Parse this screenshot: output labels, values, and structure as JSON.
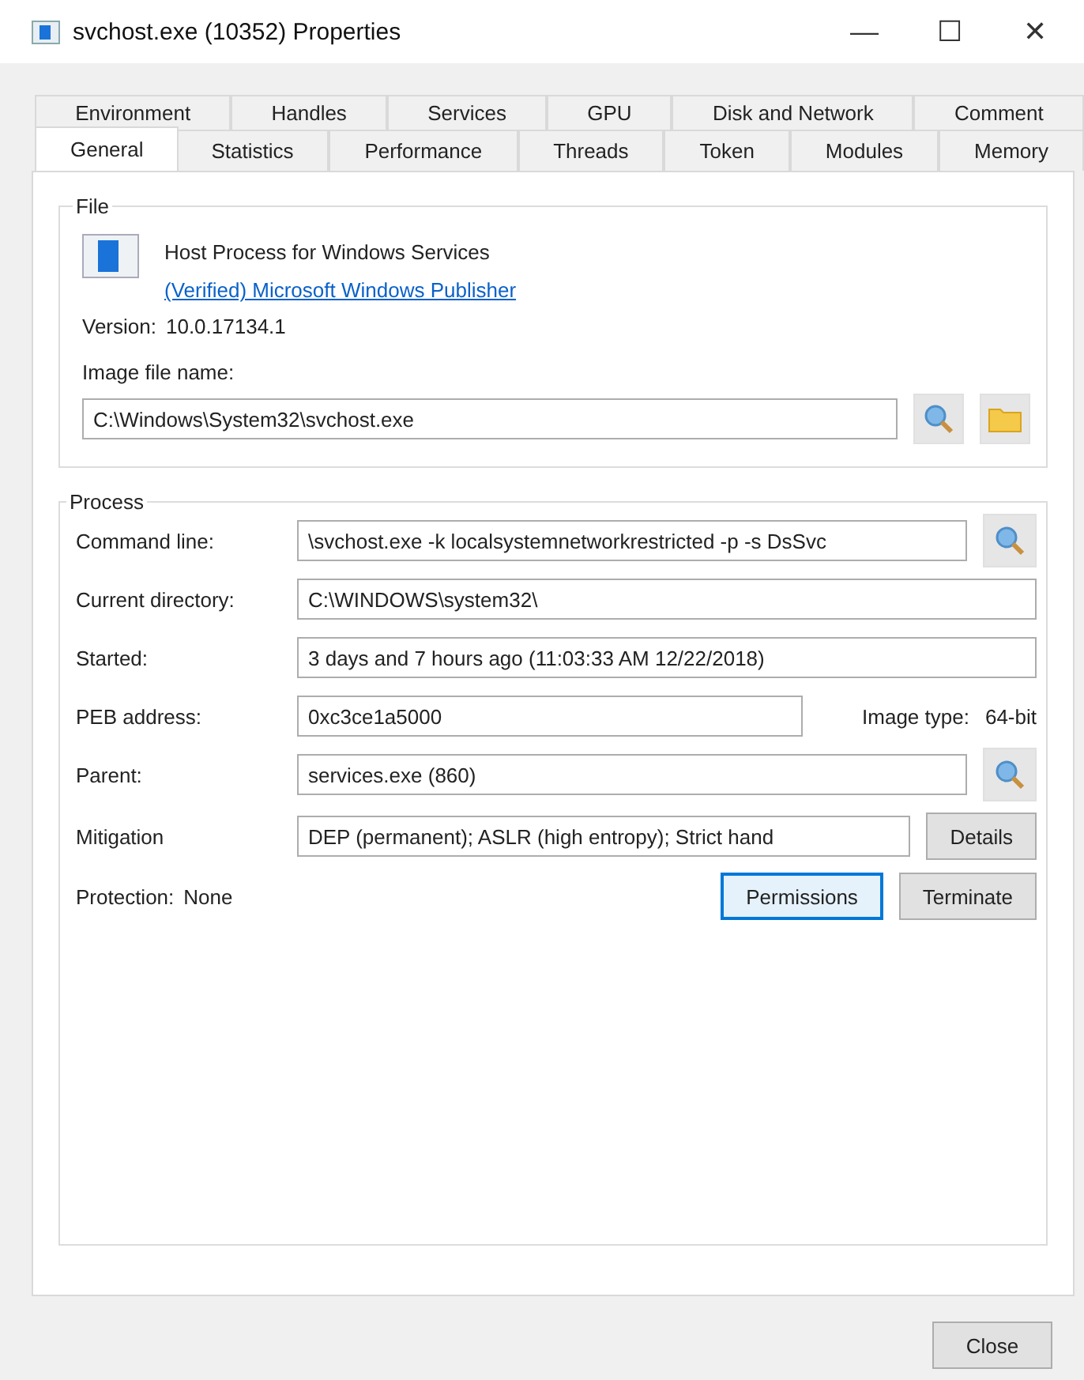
{
  "window": {
    "title": "svchost.exe (10352) Properties",
    "controls": [
      "—",
      "☐",
      "✕"
    ]
  },
  "tab_rows": [
    [
      {
        "label": "Environment",
        "selected": false
      },
      {
        "label": "Handles",
        "selected": false
      },
      {
        "label": "Services",
        "selected": false
      },
      {
        "label": "GPU",
        "selected": false
      },
      {
        "label": "Disk and Network",
        "selected": false
      },
      {
        "label": "Comment",
        "selected": false
      }
    ],
    [
      {
        "label": "General",
        "selected": true
      },
      {
        "label": "Statistics",
        "selected": false
      },
      {
        "label": "Performance",
        "selected": false
      },
      {
        "label": "Threads",
        "selected": false
      },
      {
        "label": "Token",
        "selected": false
      },
      {
        "label": "Modules",
        "selected": false
      },
      {
        "label": "Memory",
        "selected": false
      }
    ]
  ],
  "file": {
    "title": "File",
    "description": "Host Process for Windows Services",
    "publisher": "(Verified) Microsoft Windows Publisher",
    "version_label": "Version:",
    "version": "10.0.17134.1",
    "image_label": "Image file name:",
    "image_path": "C:\\Windows\\System32\\svchost.exe"
  },
  "process": {
    "title": "Process",
    "rows": [
      {
        "label": "Command line:",
        "value": "\\svchost.exe -k localsystemnetworkrestricted -p -s DsSvc",
        "kind": "search"
      },
      {
        "label": "Current directory:",
        "value": "C:\\WINDOWS\\system32\\",
        "kind": "plain"
      },
      {
        "label": "Started:",
        "value": "3 days and 7 hours ago (11:03:33 AM 12/22/2018)",
        "kind": "plain"
      },
      {
        "label": "PEB address:",
        "value": "0xc3ce1a5000",
        "kind": "info",
        "info_label": "Image type:",
        "info_value": "64-bit"
      },
      {
        "label": "Parent:",
        "value": "services.exe (860)",
        "kind": "search"
      },
      {
        "label": "Mitigation",
        "value": "DEP (permanent); ASLR (high entropy); Strict hand",
        "kind": "button",
        "button": "Details"
      }
    ],
    "protection_label": "Protection:",
    "protection": "None",
    "buttons": [
      {
        "label": "Permissions",
        "focused": true
      },
      {
        "label": "Terminate",
        "focused": false
      }
    ]
  },
  "footer": {
    "button": "Close"
  }
}
